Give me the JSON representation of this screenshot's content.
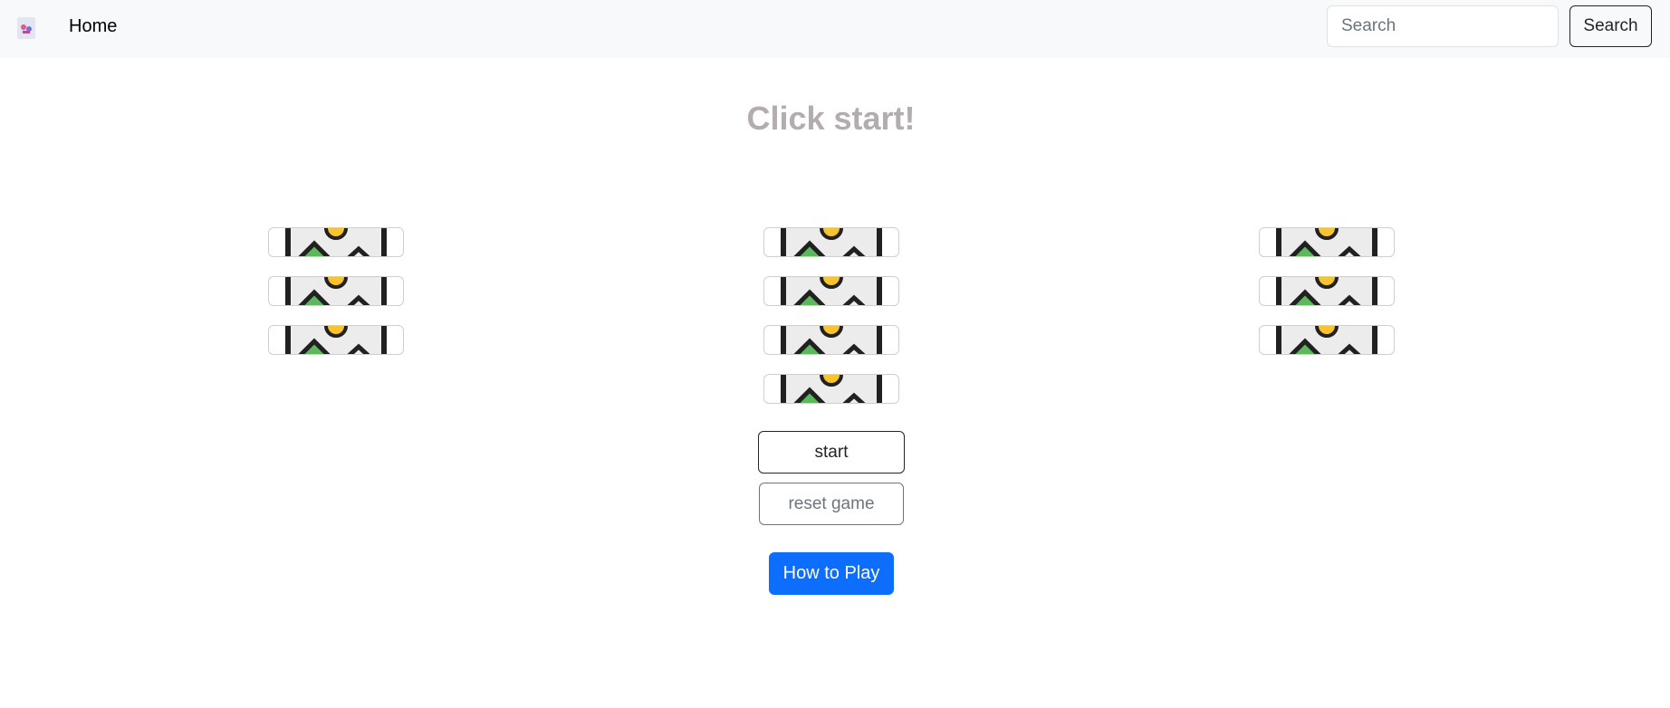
{
  "navbar": {
    "logo_icon": "app-logo-icon",
    "home_label": "Home",
    "search": {
      "placeholder": "Search",
      "value": ""
    },
    "search_button_label": "Search"
  },
  "game": {
    "status_text": "Click start!",
    "tower_icon": "image-placeholder-icon",
    "columns": [
      {
        "name": "left",
        "tower_count": 3
      },
      {
        "name": "middle",
        "tower_count": 4
      },
      {
        "name": "right",
        "tower_count": 3
      }
    ],
    "start_label": "start",
    "reset_label": "reset game",
    "how_to_play_label": "How to Play"
  },
  "colors": {
    "navbar_bg": "#f8f9fa",
    "status_text": "#b3adad",
    "primary": "#0d6efd",
    "secondary": "#6c757d",
    "icon_sun": "#f7c32e",
    "icon_mountain": "#5cb85c",
    "icon_dark": "#212121"
  }
}
